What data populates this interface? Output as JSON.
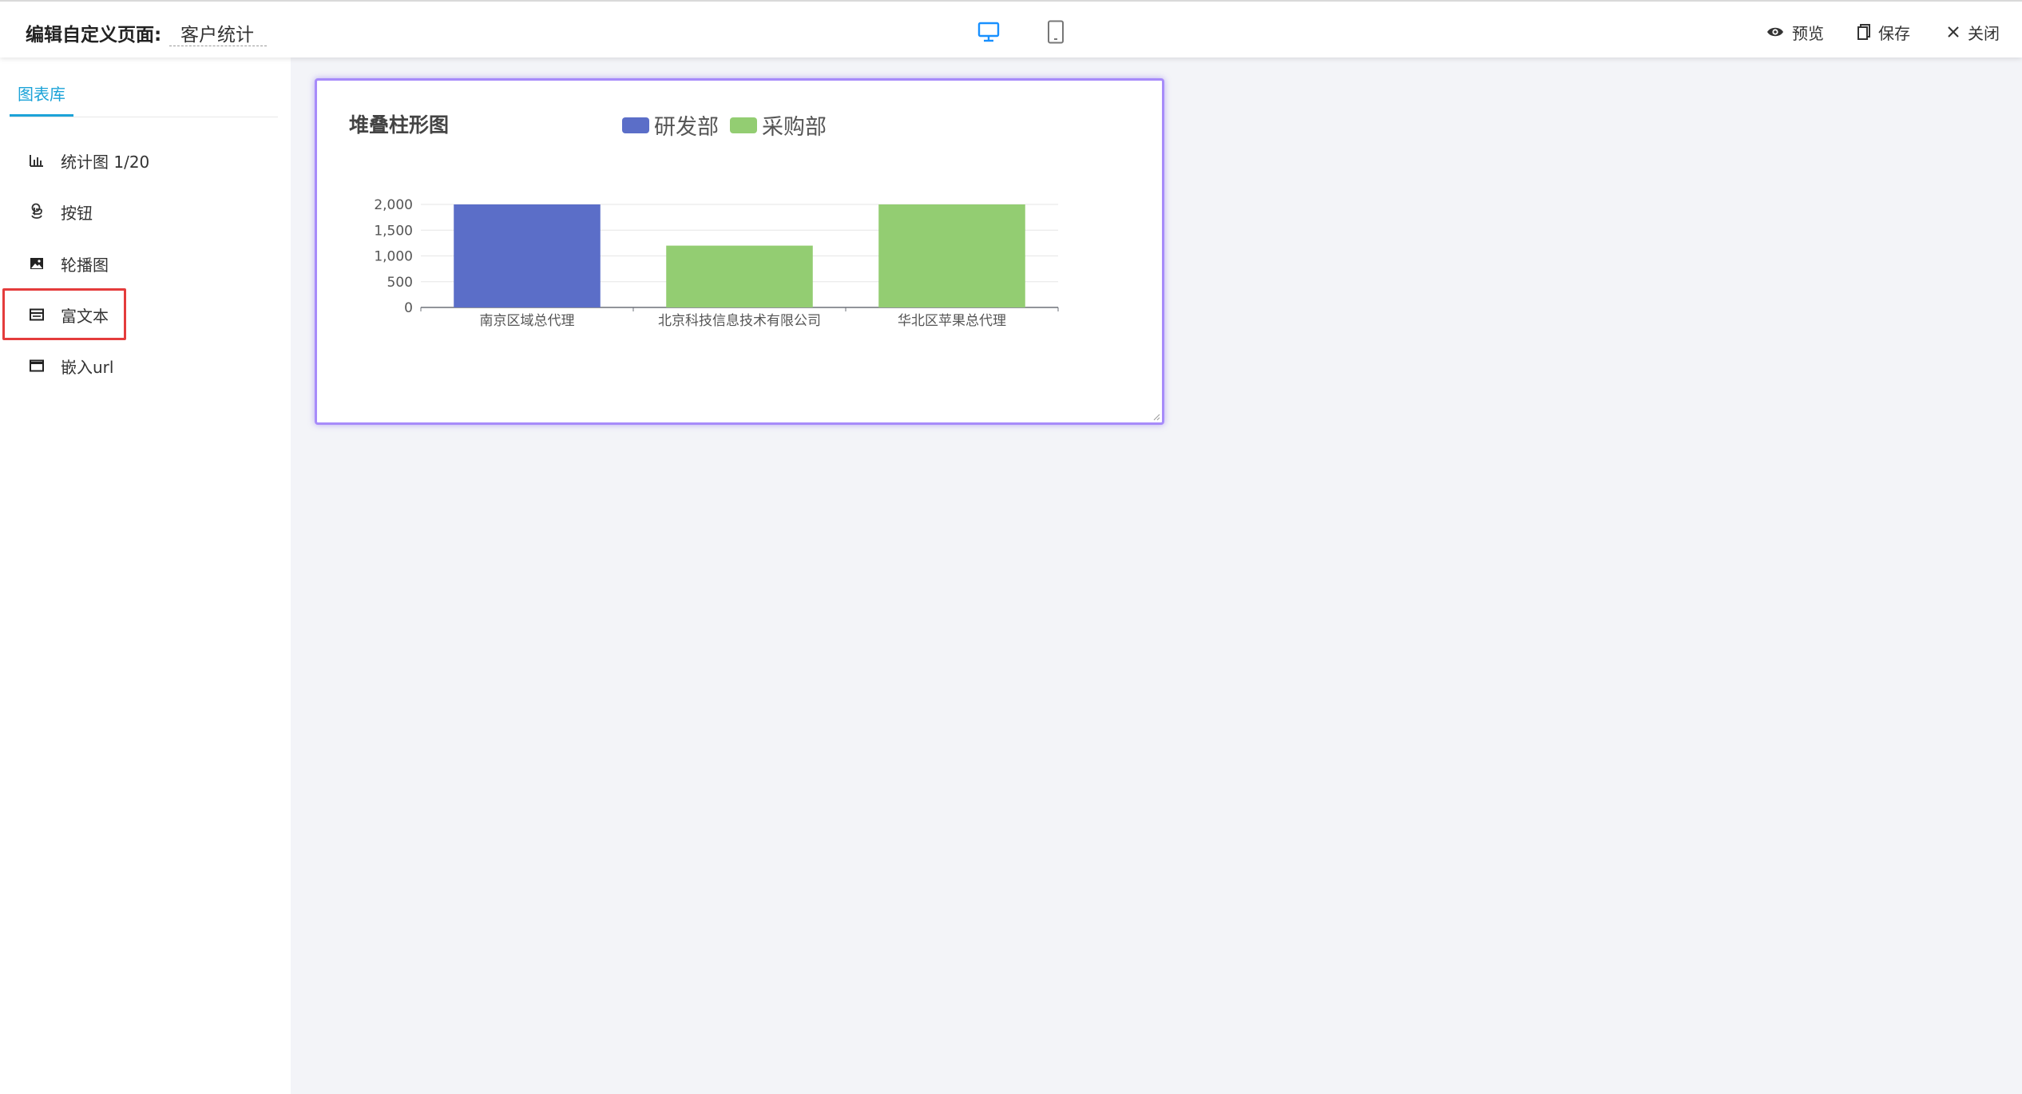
{
  "header": {
    "page_label": "编辑自定义页面:",
    "page_name": "客户统计",
    "devices": [
      "desktop-icon",
      "mobile-icon"
    ],
    "actions": {
      "preview": "预览",
      "save": "保存",
      "close": "关闭"
    },
    "accent": "#1890ff"
  },
  "sidebar": {
    "tab_label": "图表库",
    "items": [
      {
        "label": "统计图 1/20",
        "icon": "bar-chart-icon"
      },
      {
        "label": "按钮",
        "icon": "button-icon"
      },
      {
        "label": "轮播图",
        "icon": "image-icon"
      },
      {
        "label": "富文本",
        "icon": "rich-text-icon"
      },
      {
        "label": "嵌入url",
        "icon": "window-icon"
      }
    ],
    "accent": "#1ca3d8",
    "highlighted_item": "富文本"
  },
  "chart_data": {
    "type": "bar",
    "title": "堆叠柱形图",
    "categories": [
      "南京区域总代理",
      "北京科技信息技术有限公司",
      "华北区苹果总代理"
    ],
    "series": [
      {
        "name": "研发部",
        "color": "#5b6ec8",
        "values": [
          2000,
          0,
          0
        ]
      },
      {
        "name": "采购部",
        "color": "#93cd72",
        "values": [
          0,
          1200,
          2000
        ]
      }
    ],
    "yticks": [
      "0",
      "500",
      "1,000",
      "1,500",
      "2,000"
    ],
    "ylim": [
      0,
      2000
    ],
    "xlabel": "",
    "ylabel": "",
    "grid": true,
    "legend": "top"
  }
}
